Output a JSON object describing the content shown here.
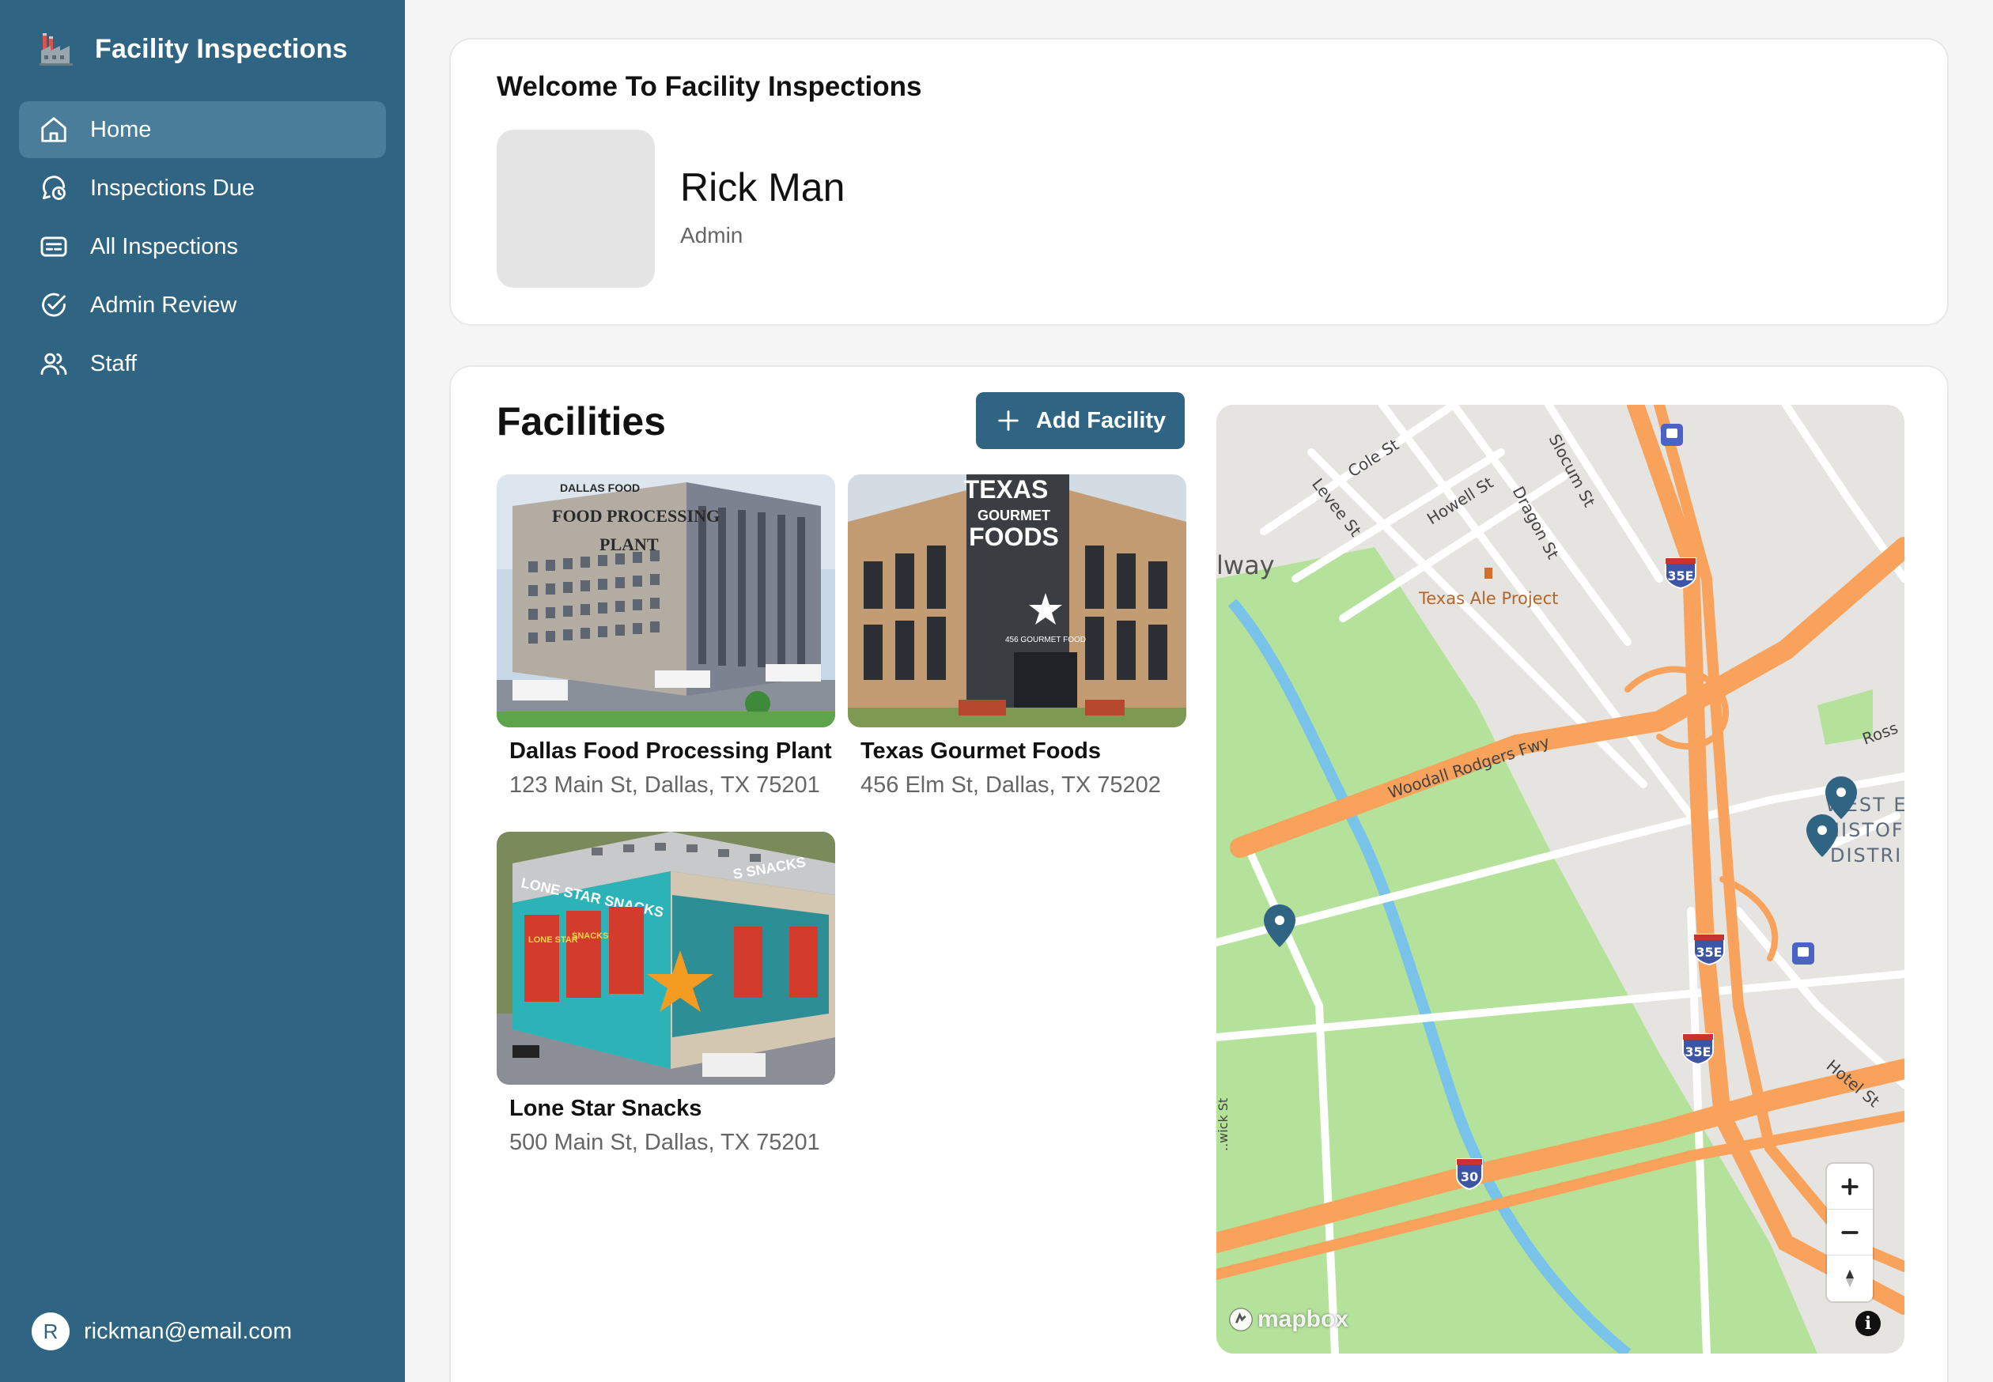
{
  "app": {
    "title": "Facility Inspections"
  },
  "sidebar": {
    "items": [
      {
        "label": "Home",
        "icon": "home-icon",
        "active": true
      },
      {
        "label": "Inspections Due",
        "icon": "clock-chat-icon",
        "active": false
      },
      {
        "label": "All Inspections",
        "icon": "list-card-icon",
        "active": false
      },
      {
        "label": "Admin Review",
        "icon": "check-circle-icon",
        "active": false
      },
      {
        "label": "Staff",
        "icon": "users-icon",
        "active": false
      }
    ],
    "user_initial": "R",
    "user_email": "rickman@email.com"
  },
  "welcome": {
    "title": "Welcome To Facility Inspections",
    "name": "Rick Man",
    "role": "Admin"
  },
  "facilities": {
    "title": "Facilities",
    "add_label": "Add Facility",
    "items": [
      {
        "name": "Dallas Food Processing Plant",
        "address": "123 Main St, Dallas, TX 75201",
        "image_text": [
          "DALLAS FOOD",
          "FOOD PROCESSING",
          "PLANT"
        ]
      },
      {
        "name": "Texas Gourmet Foods",
        "address": "456 Elm St, Dallas, TX 75202",
        "image_text": [
          "TEXAS",
          "GOURMET",
          "FOODS",
          "456 GOURMET FOOD"
        ]
      },
      {
        "name": "Lone Star Snacks",
        "address": "500 Main St, Dallas, TX 75201",
        "image_text": [
          "LONE STAR SNACKS",
          "S SNACKS",
          "LONE STAR",
          "SNACKS"
        ]
      }
    ]
  },
  "map": {
    "labels": {
      "cole": "Cole St",
      "levee": "Levee St",
      "howell": "Howell St",
      "dragon": "Dragon St",
      "slocum": "Slocum St",
      "way": "lway",
      "ale": "Texas Ale Project",
      "woodall": "Woodall Rodgers Fwy",
      "ross": "Ross",
      "west": "WEST E",
      "histo": "HISTOF",
      "distri": "DISTRI",
      "hotel": "Hotel St",
      "wick": "..wick St"
    },
    "shields": {
      "i35e": "35E",
      "i30": "30"
    },
    "brand": "mapbox",
    "info": "i",
    "colors": {
      "water": "#79c2ea",
      "park": "#b5e29a",
      "highway": "#f9a25b",
      "marker": "#2f6482"
    }
  },
  "colors": {
    "sidebar": "#2f6482",
    "sidebar_active": "#4a7d99",
    "button": "#2f6482"
  }
}
